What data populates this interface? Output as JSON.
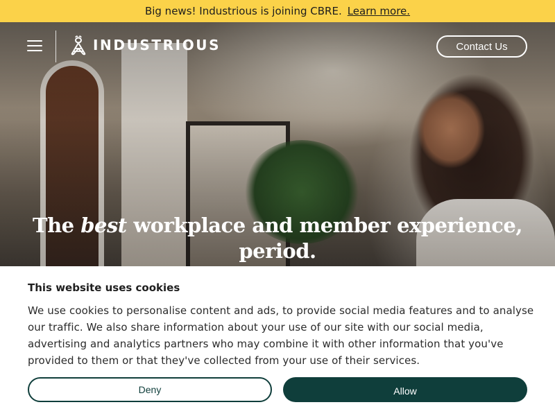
{
  "banner": {
    "text": "Big news! Industrious is joining CBRE.",
    "link_label": "Learn more."
  },
  "header": {
    "menu_icon": "hamburger-menu-icon",
    "logo_icon": "bee-icon",
    "logo_text": "INDUSTRIOUS",
    "contact_label": "Contact Us"
  },
  "hero": {
    "headline_pre": "The",
    "headline_emphasis": "best",
    "headline_post": "workplace and member experience, period."
  },
  "cookie": {
    "title": "This website uses cookies",
    "body": "We use cookies to personalise content and ads, to provide social media features and to analyse our traffic. We also share information about your use of our site with our social media, advertising and analytics partners who may combine it with other information that you've provided to them or that they've collected from your use of their services.",
    "deny_label": "Deny",
    "allow_label": "Allow"
  },
  "colors": {
    "banner": "#fbd249",
    "brand_dark": "#0f3e3b",
    "white": "#ffffff"
  }
}
